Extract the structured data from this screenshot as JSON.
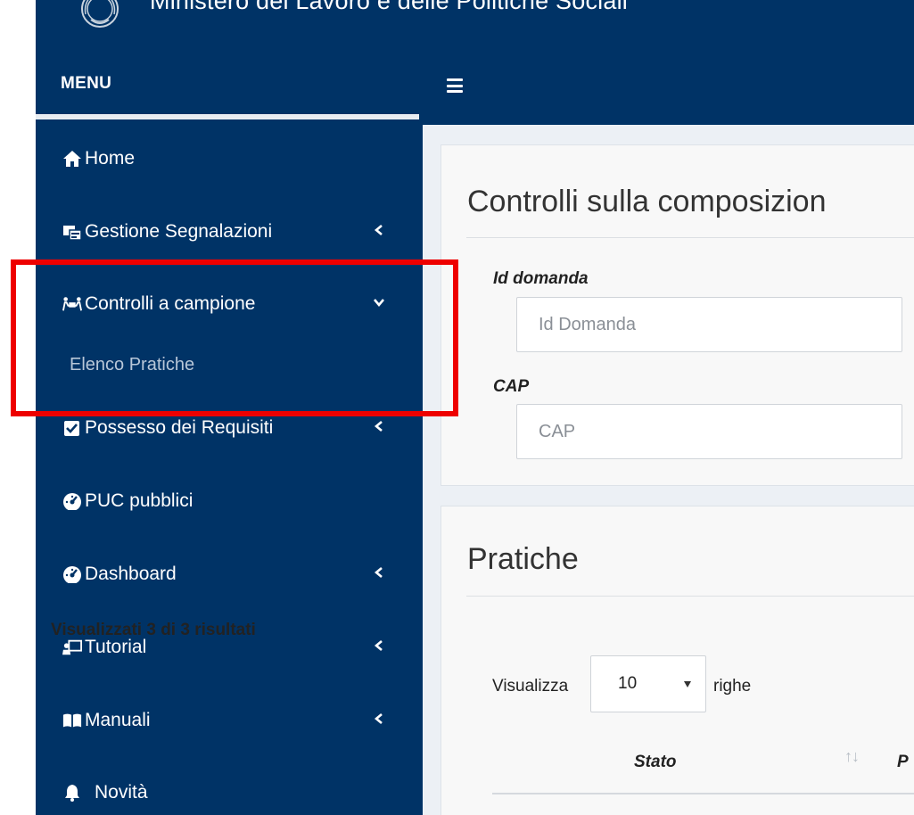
{
  "banner": {
    "title": "Ministero del Lavoro e delle Politiche Sociali"
  },
  "menu": {
    "header": "MENU"
  },
  "sidebar": {
    "items": [
      {
        "label": "Home",
        "icon": "home-icon"
      },
      {
        "label": "Gestione Segnalazioni",
        "icon": "reports-icon"
      },
      {
        "label": "Controlli a campione",
        "icon": "group-icon",
        "expanded": true,
        "children": [
          {
            "label": "Elenco Pratiche"
          }
        ]
      },
      {
        "label": "Possesso dei Requisiti",
        "icon": "checkbox-icon"
      },
      {
        "label": "PUC pubblici",
        "icon": "gauge-icon"
      },
      {
        "label": "Dashboard",
        "icon": "gauge-icon"
      },
      {
        "label": "Tutorial",
        "icon": "tutorial-icon"
      },
      {
        "label": "Manuali",
        "icon": "book-icon"
      },
      {
        "label": "Novità",
        "icon": "bell-icon"
      }
    ]
  },
  "filters": {
    "title": "Controlli sulla composizion",
    "id_domanda": {
      "label": "Id domanda",
      "placeholder": "Id Domanda",
      "value": ""
    },
    "cap": {
      "label": "CAP",
      "placeholder": "CAP",
      "value": ""
    }
  },
  "results": {
    "title": "Pratiche",
    "count_text": "Visualizzati 3 di 3 risultati",
    "show_label": "Visualizza",
    "rows_value": "10",
    "rows_label": "righe",
    "columns": [
      {
        "label": "Stato"
      },
      {
        "label": "P"
      }
    ]
  },
  "colors": {
    "primary": "#003366",
    "content_bg": "#ecf0f5",
    "highlight": "#ee0000",
    "sub_item": "#b8c7d8"
  }
}
